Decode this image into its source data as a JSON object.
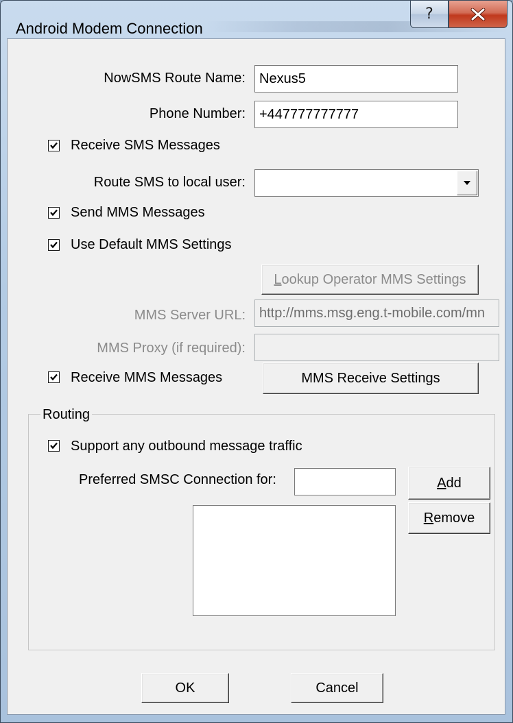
{
  "window": {
    "title": "Android Modem Connection",
    "help_glyph": "?",
    "close_icon": "close-x-icon"
  },
  "fields": {
    "route_name_label": "NowSMS Route Name:",
    "route_name_value": "Nexus5",
    "phone_number_label": "Phone Number:",
    "phone_number_value": "+447777777777",
    "route_sms_label": "Route SMS to local user:",
    "route_sms_value": "",
    "mms_server_url_label": "MMS Server URL:",
    "mms_server_url_value": "http://mms.msg.eng.t-mobile.com/mn",
    "mms_proxy_label": "MMS Proxy (if required):",
    "mms_proxy_value": ""
  },
  "checkboxes": {
    "receive_sms": {
      "label": "Receive SMS Messages",
      "checked": true
    },
    "send_mms": {
      "label": "Send MMS Messages",
      "checked": true
    },
    "default_mms": {
      "label": "Use Default MMS Settings",
      "checked": true
    },
    "receive_mms": {
      "label": "Receive MMS Messages",
      "checked": true
    },
    "support_outbound": {
      "label": "Support any outbound message traffic",
      "checked": true
    }
  },
  "buttons": {
    "lookup_prefix": "L",
    "lookup_rest": "ookup Operator MMS Settings",
    "mms_receive": "MMS Receive Settings",
    "add_prefix": "A",
    "add_rest": "dd",
    "remove_prefix": "R",
    "remove_rest": "emove",
    "ok": "OK",
    "cancel": "Cancel"
  },
  "routing": {
    "group_label": "Routing",
    "preferred_label": "Preferred SMSC Connection for:",
    "preferred_value": "",
    "list_items": []
  }
}
